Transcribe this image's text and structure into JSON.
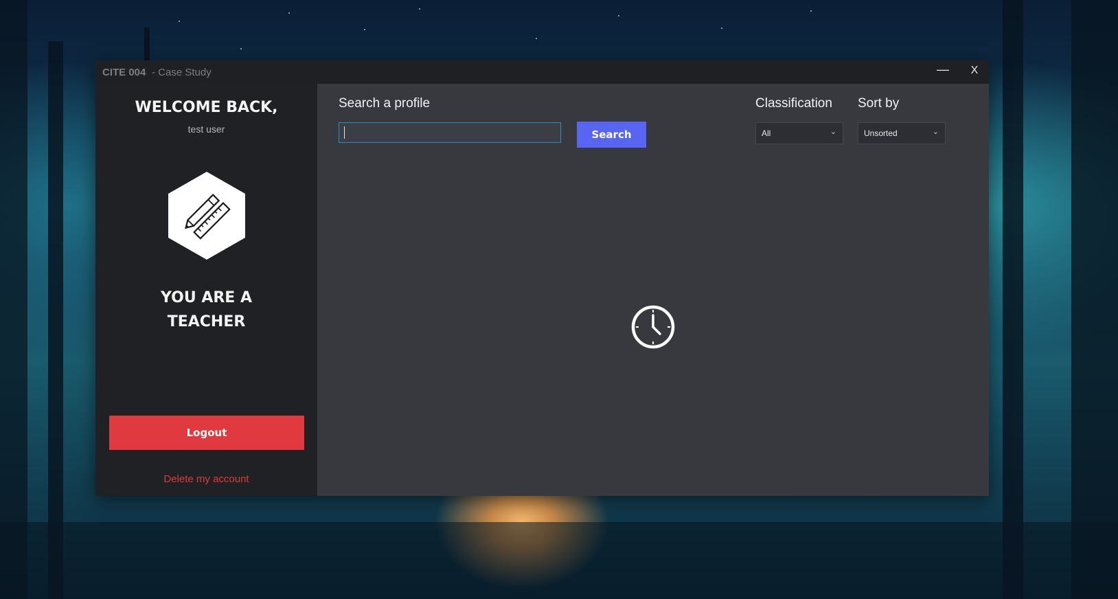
{
  "window": {
    "app_name": "CITE 004",
    "subtitle": "- Case Study",
    "minimize_label": "—",
    "close_label": "X"
  },
  "sidebar": {
    "welcome": "WELCOME BACK,",
    "username": "test user",
    "role_icon": "pencil-ruler-icon",
    "role_line1": "YOU ARE A",
    "role_line2": "TEACHER",
    "logout_label": "Logout",
    "delete_label": "Delete my account"
  },
  "main": {
    "search_label": "Search a profile",
    "search_value": "",
    "search_button": "Search",
    "classification_label": "Classification",
    "classification_value": "All",
    "sort_label": "Sort by",
    "sort_value": "Unsorted",
    "status_icon": "clock-icon"
  },
  "colors": {
    "accent": "#5865f2",
    "danger": "#e0393f",
    "sidebar_bg": "#202125",
    "main_bg": "#37393f",
    "input_focus": "#2f8ec9"
  }
}
